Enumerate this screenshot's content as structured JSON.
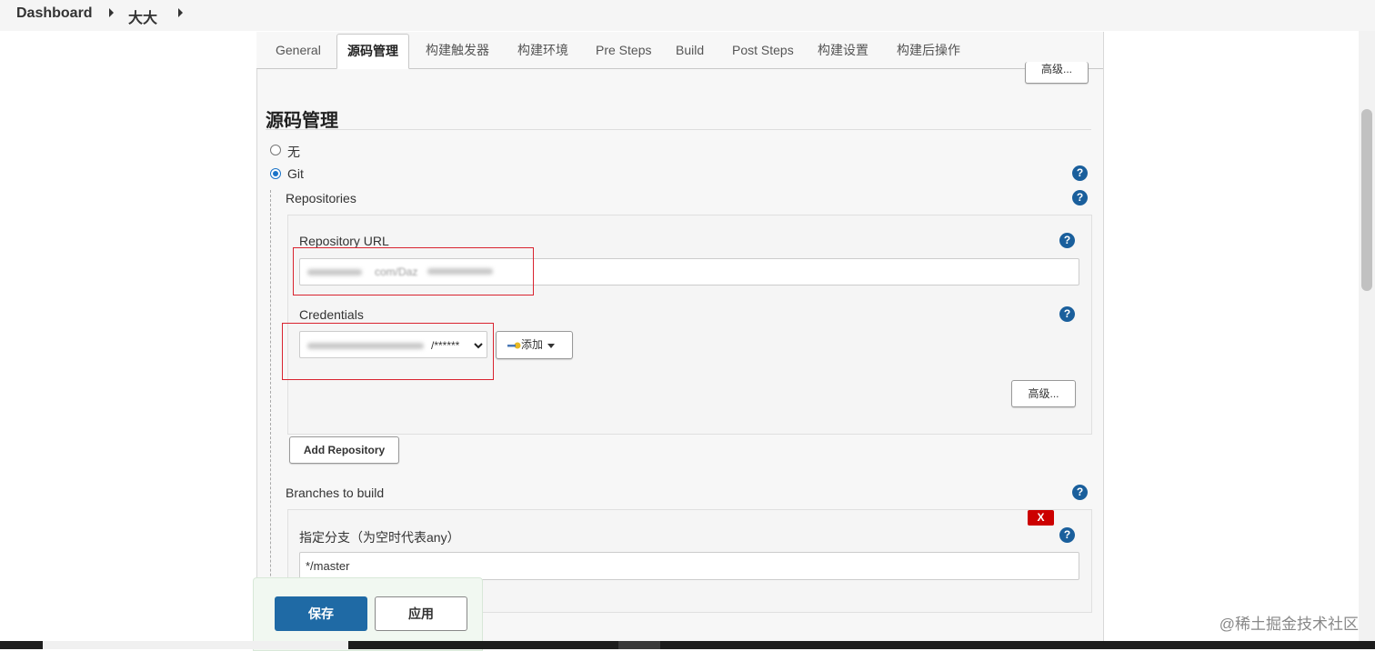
{
  "breadcrumb": {
    "root": "Dashboard",
    "job": "大大"
  },
  "tabs": [
    "General",
    "源码管理",
    "构建触发器",
    "构建环境",
    "Pre Steps",
    "Build",
    "Post Steps",
    "构建设置",
    "构建后操作"
  ],
  "top_advanced_label": "高级...",
  "section": {
    "title": "源码管理"
  },
  "scm": {
    "none_label": "无",
    "git_label": "Git",
    "selected": "Git"
  },
  "repositories": {
    "label": "Repositories",
    "repo_url_label": "Repository URL",
    "repo_url_value_visible": "com/Daz",
    "credentials_label": "Credentials",
    "credentials_value_visible": "/******",
    "add_label": "添加",
    "advanced_label": "高级...",
    "add_repository_label": "Add Repository"
  },
  "branches": {
    "label": "Branches to build",
    "delete_label": "X",
    "spec_label": "指定分支（为空时代表any）",
    "spec_value": "*/master"
  },
  "actions": {
    "save": "保存",
    "apply": "应用"
  },
  "help_icon_label": "?",
  "watermark": "@稀土掘金技术社区",
  "colors": {
    "primary": "#1f6aa5",
    "help": "#1a5f9c",
    "danger": "#cc0000",
    "highlight": "#d9232f"
  }
}
